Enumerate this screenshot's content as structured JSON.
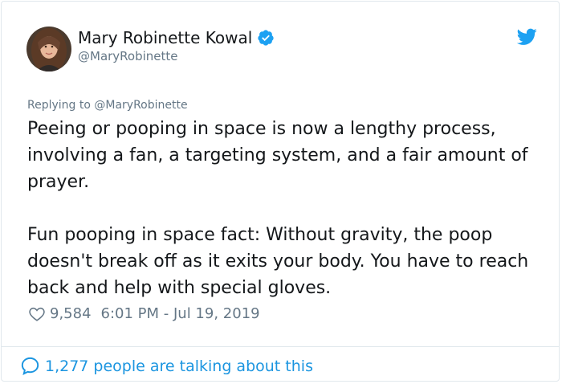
{
  "author": {
    "display_name": "Mary Robinette Kowal",
    "handle": "@MaryRobinette",
    "verified": true
  },
  "reply_to": "Replying to @MaryRobinette",
  "tweet": {
    "paragraphs": [
      "Peeing or pooping in space is now a lengthy process, involving a fan, a targeting system, and a fair amount of prayer.",
      "Fun pooping in space fact: Without gravity, the poop doesn't break off as it exits your body. You have to reach back and help with special gloves."
    ]
  },
  "meta": {
    "likes": "9,584",
    "timestamp": "6:01 PM - Jul 19, 2019"
  },
  "footer": {
    "talking": "1,277 people are talking about this"
  },
  "icons": {
    "verified": "verified-badge-icon",
    "twitter": "twitter-bird-icon",
    "like": "heart-icon",
    "reply": "speech-bubble-icon"
  },
  "colors": {
    "accent": "#1b95e0",
    "verified": "#1da1f2",
    "text": "#14171a",
    "secondary": "#657786",
    "border": "#e1e8ed"
  }
}
